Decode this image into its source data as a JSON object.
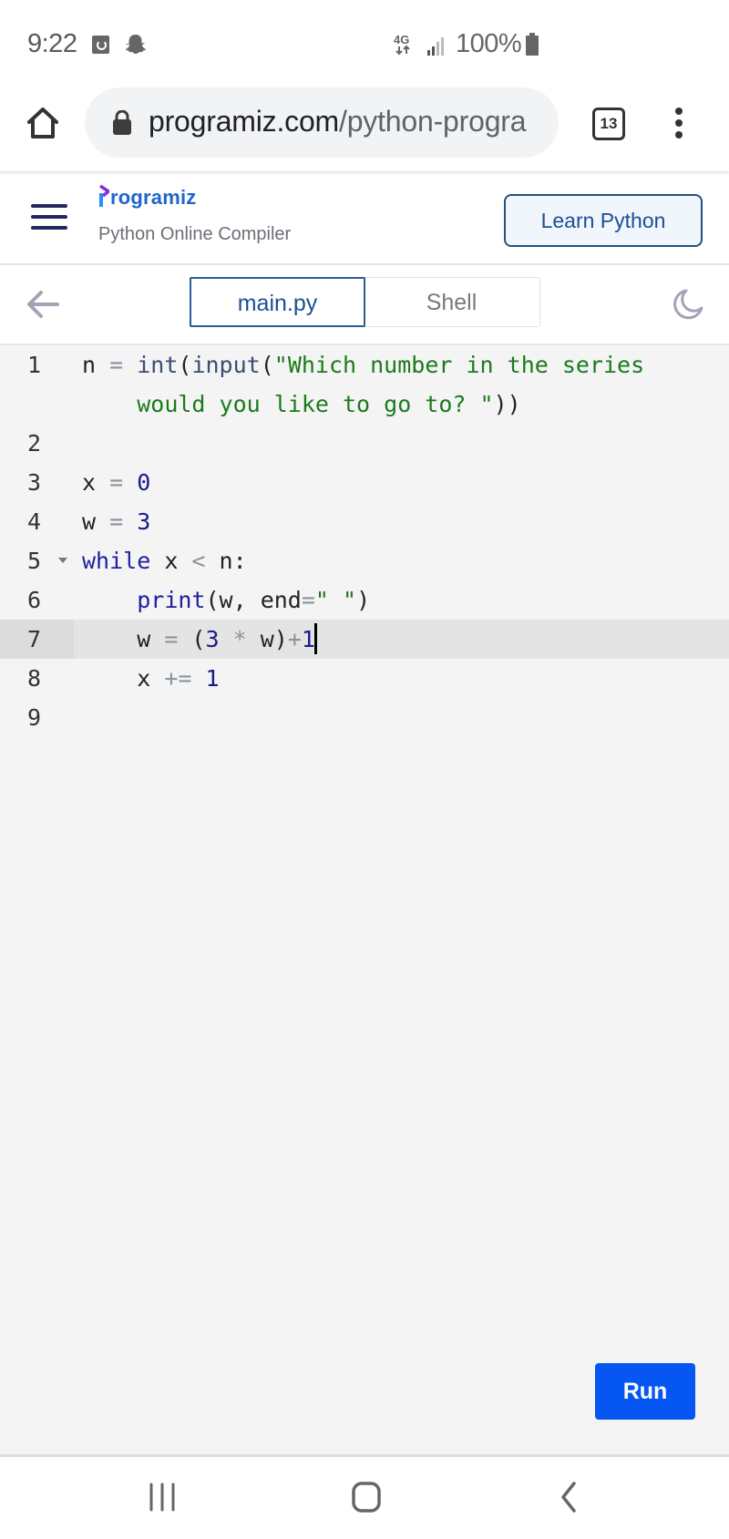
{
  "status_bar": {
    "time": "9:22",
    "notification_icons": [
      "app-notification-icon",
      "snapchat-icon"
    ],
    "network": "4G",
    "battery_percent": "100%"
  },
  "browser": {
    "url_host": "programiz.com",
    "url_path": "/python-progra",
    "tab_count": "13"
  },
  "site_header": {
    "logo_text": "rogramiz",
    "subtitle": "Python Online Compiler",
    "learn_button": "Learn Python"
  },
  "tabs": [
    {
      "label": "main.py",
      "active": true
    },
    {
      "label": "Shell",
      "active": false
    }
  ],
  "editor": {
    "active_line": 7,
    "lines": [
      {
        "num": "1",
        "tokens": [
          [
            "plain",
            "n "
          ],
          [
            "op",
            "= "
          ],
          [
            "builtin",
            "int"
          ],
          [
            "plain",
            "("
          ],
          [
            "builtin",
            "input"
          ],
          [
            "plain",
            "("
          ],
          [
            "str",
            "\"Which number in the series"
          ]
        ]
      },
      {
        "num": "",
        "tokens": [
          [
            "plain",
            "    "
          ],
          [
            "str",
            "would you like to go to? \""
          ],
          [
            "plain",
            "))"
          ]
        ]
      },
      {
        "num": "2",
        "tokens": []
      },
      {
        "num": "3",
        "tokens": [
          [
            "plain",
            "x "
          ],
          [
            "op",
            "= "
          ],
          [
            "num",
            "0"
          ]
        ]
      },
      {
        "num": "4",
        "tokens": [
          [
            "plain",
            "w "
          ],
          [
            "op",
            "= "
          ],
          [
            "num",
            "3"
          ]
        ]
      },
      {
        "num": "5",
        "fold": true,
        "tokens": [
          [
            "kw",
            "while"
          ],
          [
            "plain",
            " x "
          ],
          [
            "op",
            "<"
          ],
          [
            "plain",
            " n:"
          ]
        ]
      },
      {
        "num": "6",
        "tokens": [
          [
            "plain",
            "    "
          ],
          [
            "kw",
            "print"
          ],
          [
            "plain",
            "(w, end"
          ],
          [
            "op",
            "="
          ],
          [
            "str",
            "\" \""
          ],
          [
            "plain",
            ")"
          ]
        ]
      },
      {
        "num": "7",
        "tokens": [
          [
            "plain",
            "    w "
          ],
          [
            "op",
            "= "
          ],
          [
            "plain",
            "("
          ],
          [
            "num",
            "3"
          ],
          [
            "op",
            " * "
          ],
          [
            "plain",
            "w)"
          ],
          [
            "op",
            "+"
          ],
          [
            "num",
            "1"
          ]
        ],
        "cursor": true
      },
      {
        "num": "8",
        "tokens": [
          [
            "plain",
            "    x "
          ],
          [
            "op",
            "+= "
          ],
          [
            "num",
            "1"
          ]
        ]
      },
      {
        "num": "9",
        "tokens": []
      }
    ],
    "run_button": "Run"
  },
  "nav_bar": {
    "buttons": [
      "recent-apps",
      "home",
      "back"
    ]
  }
}
